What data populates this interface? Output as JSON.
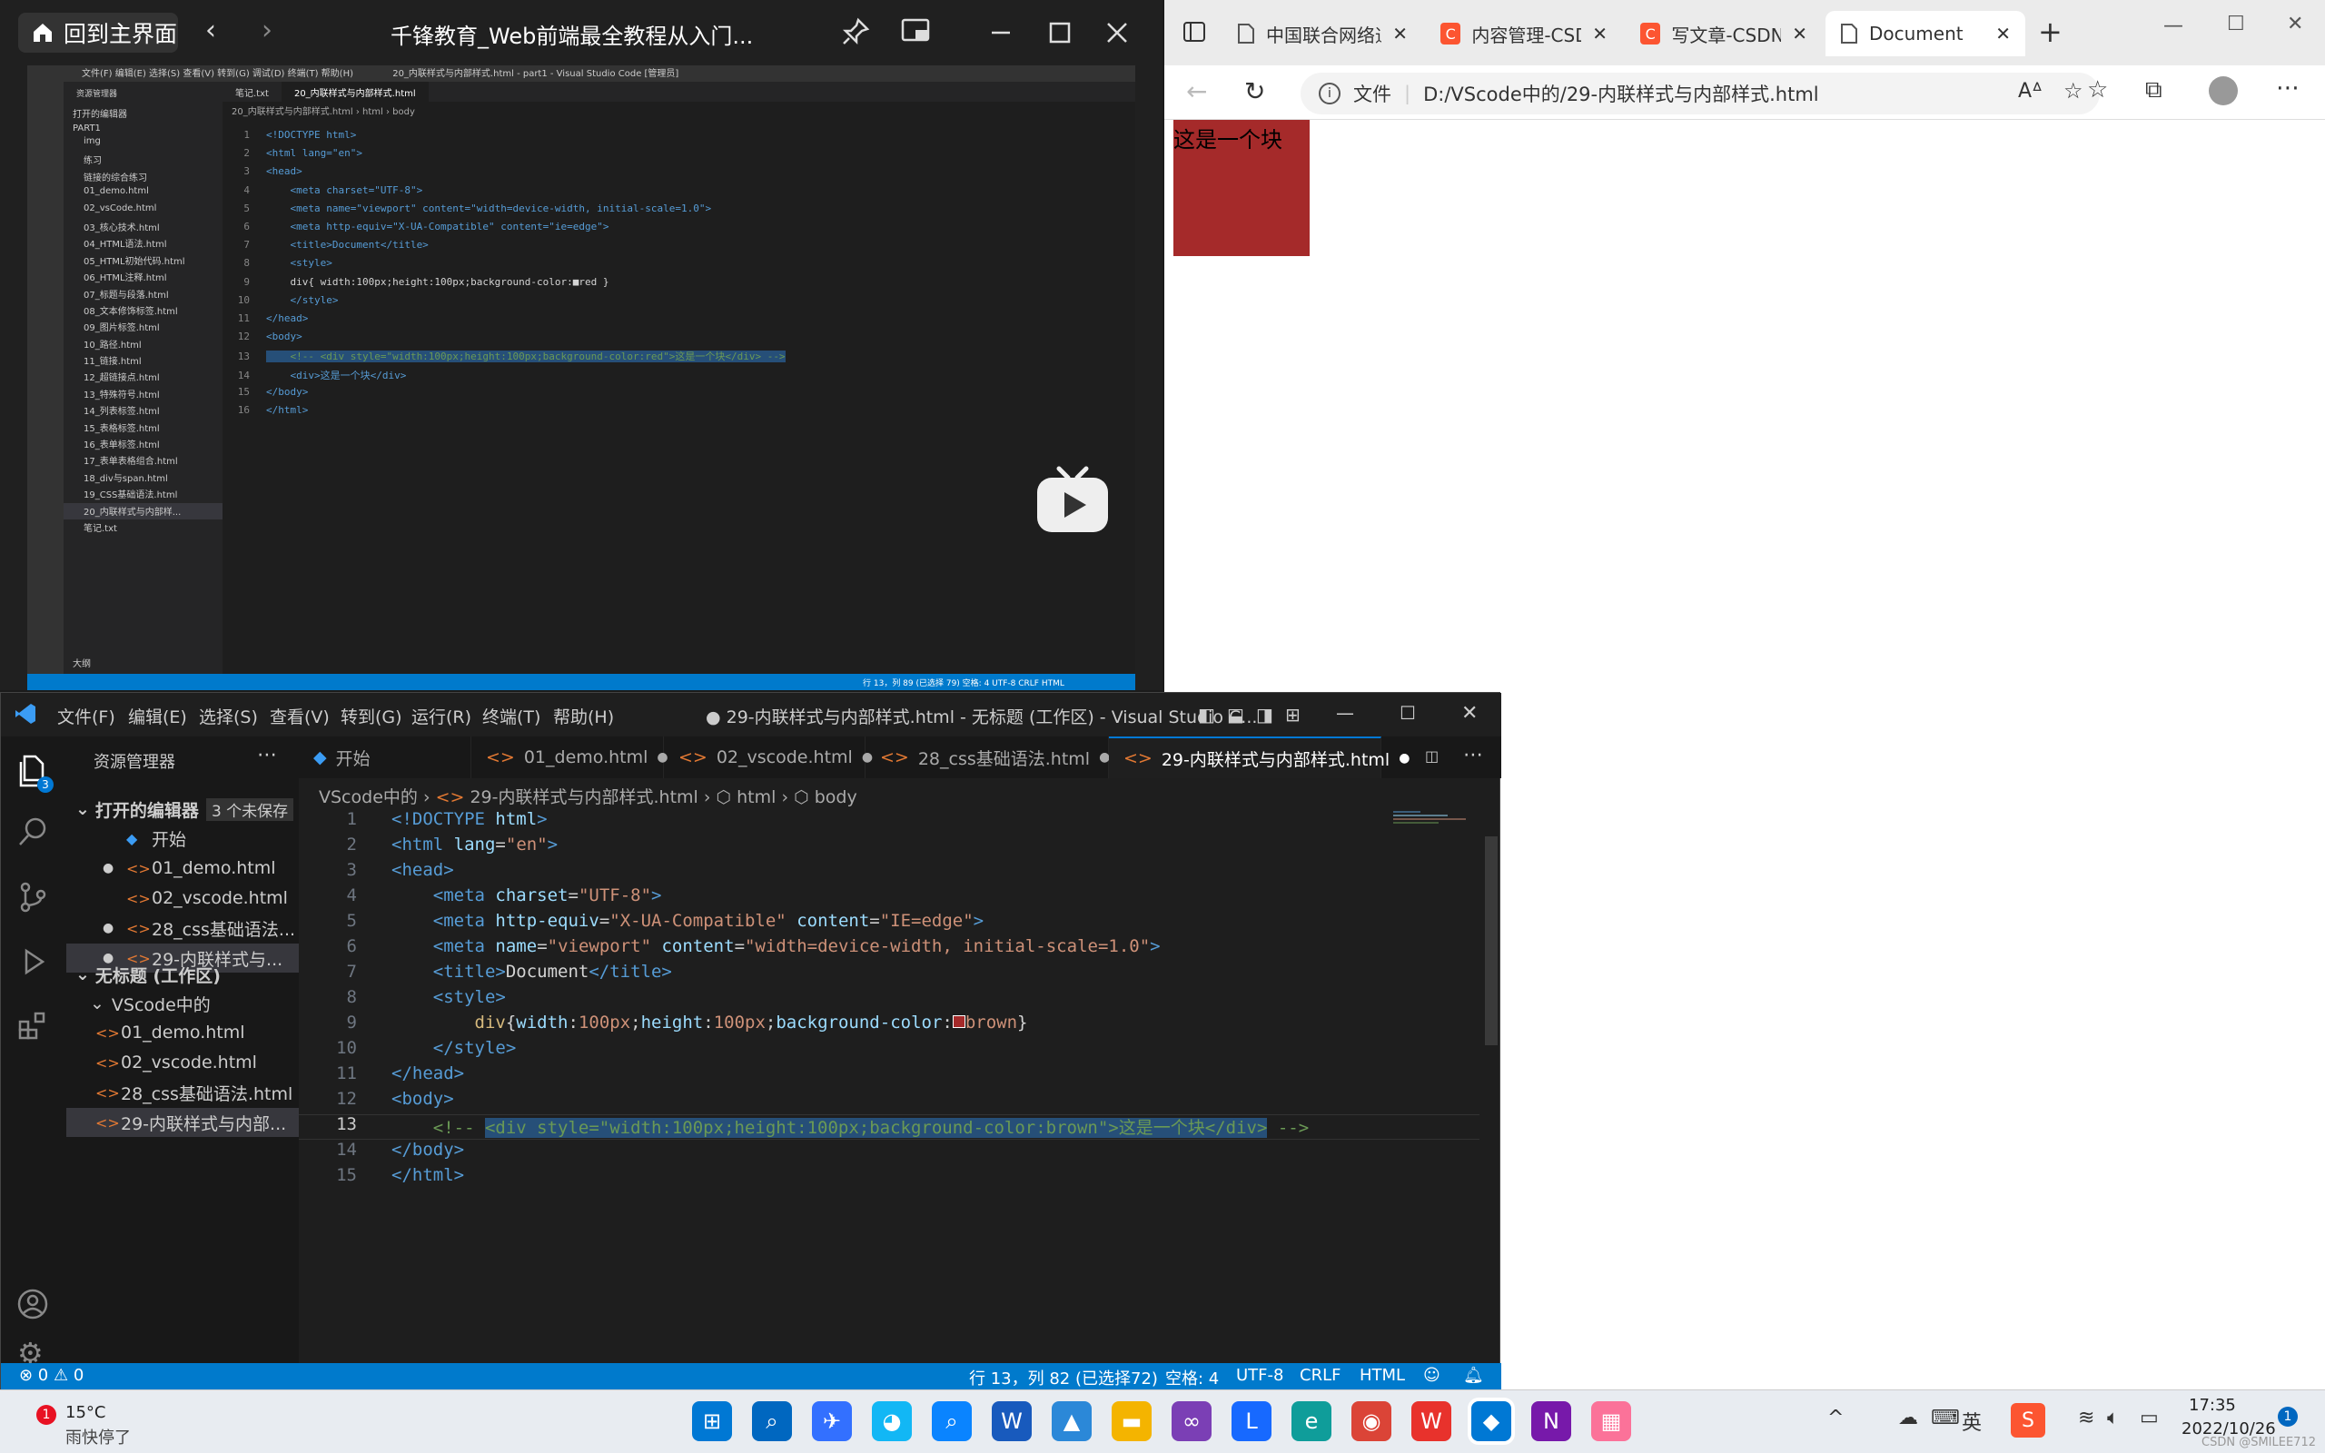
{
  "video_window": {
    "home_label": "回到主界面",
    "title": "千锋教育_Web前端最全教程从入门...",
    "inner_vscode": {
      "title": "20_内联样式与内部样式.html - part1 - Visual Studio Code [管理员]",
      "menu": [
        "文件(F)",
        "编辑(E)",
        "选择(S)",
        "查看(V)",
        "转到(G)",
        "调试(D)",
        "终端(T)",
        "帮助(H)"
      ],
      "explorer_label": "资源管理器",
      "open_editors": "打开的编辑器",
      "folder": "PART1",
      "files": [
        "img",
        "练习",
        "链接的综合练习",
        "01_demo.html",
        "02_vsCode.html",
        "03_核心技术.html",
        "04_HTML语法.html",
        "05_HTML初始代码.html",
        "06_HTML注释.html",
        "07_标题与段落.html",
        "08_文本修饰标签.html",
        "09_图片标签.html",
        "10_路径.html",
        "11_链接.html",
        "12_超链接点.html",
        "13_特殊符号.html",
        "14_列表标签.html",
        "15_表格标签.html",
        "16_表单标签.html",
        "17_表单表格组合.html",
        "18_div与span.html",
        "19_CSS基础语法.html",
        "20_内联样式与内部样...",
        "笔记.txt"
      ],
      "outline": "大纲",
      "tabs": [
        "笔记.txt",
        "20_内联样式与内部样式.html"
      ],
      "crumb": "20_内联样式与内部样式.html › html › body",
      "code": [
        "<!DOCTYPE html>",
        "<html lang=\"en\">",
        "<head>",
        "    <meta charset=\"UTF-8\">",
        "    <meta name=\"viewport\" content=\"width=device-width, initial-scale=1.0\">",
        "    <meta http-equiv=\"X-UA-Compatible\" content=\"ie=edge\">",
        "    <title>Document</title>",
        "    <style>",
        "    div{ width:100px;height:100px;background-color:■red }",
        "    </style>",
        "</head>",
        "<body>",
        "    <!-- <div style=\"width:100px;height:100px;background-color:red\">这是一个块</div> -->",
        "    <div>这是一个块</div>",
        "</body>",
        "</html>"
      ],
      "status": "行 13，列 89 (已选择 79)  空格: 4  UTF-8  CRLF  HTML"
    }
  },
  "browser": {
    "tabs": [
      {
        "label": "中国联合网络通..."
      },
      {
        "label": "内容管理-CSDN..."
      },
      {
        "label": "写文章-CSDN博..."
      },
      {
        "label": "Document"
      }
    ],
    "address_label": "文件",
    "address": "D:/VScode中的/29-内联样式与内部样式.html",
    "page_text": "这是一个块",
    "block_color": "#a52a2a"
  },
  "vscode": {
    "menu": [
      "文件(F)",
      "编辑(E)",
      "选择(S)",
      "查看(V)",
      "转到(G)",
      "运行(R)",
      "终端(T)",
      "帮助(H)"
    ],
    "title": "● 29-内联样式与内部样式.html - 无标题 (工作区) - Visual Studio C...",
    "explorer_label": "资源管理器",
    "open_editors_label": "打开的编辑器",
    "unsaved_badge": "3 个未保存",
    "open_editors": [
      "开始",
      "01_demo.html",
      "02_vscode.html",
      "28_css基础语法...",
      "29-内联样式与..."
    ],
    "workspace_label": "无标题 (工作区)",
    "folder_label": "VScode中的",
    "files": [
      "01_demo.html",
      "02_vscode.html",
      "28_css基础语法.html",
      "29-内联样式与内部..."
    ],
    "tabs": [
      {
        "label": "开始"
      },
      {
        "label": "01_demo.html"
      },
      {
        "label": "02_vscode.html"
      },
      {
        "label": "28_css基础语法.html"
      },
      {
        "label": "29-内联样式与内部样式.html"
      }
    ],
    "breadcrumb": [
      "VScode中的",
      "29-内联样式与内部样式.html",
      "html",
      "body"
    ],
    "line_numbers": [
      "1",
      "2",
      "3",
      "4",
      "5",
      "6",
      "7",
      "8",
      "9",
      "10",
      "11",
      "12",
      "13",
      "14",
      "15"
    ],
    "status_left": "⊗ 0 ⚠ 0",
    "status_position": "行 13，列 82 (已选择72)",
    "status_spaces": "空格: 4",
    "status_encoding": "UTF-8",
    "status_eol": "CRLF",
    "status_lang": "HTML",
    "activity_badge": "3"
  },
  "taskbar": {
    "weather_temp": "15°C",
    "weather_desc": "雨快停了",
    "weather_badge": "1",
    "time": "17:35",
    "date": "2022/10/26",
    "notif_count": "1",
    "watermark": "CSDN @SMILEE712"
  }
}
